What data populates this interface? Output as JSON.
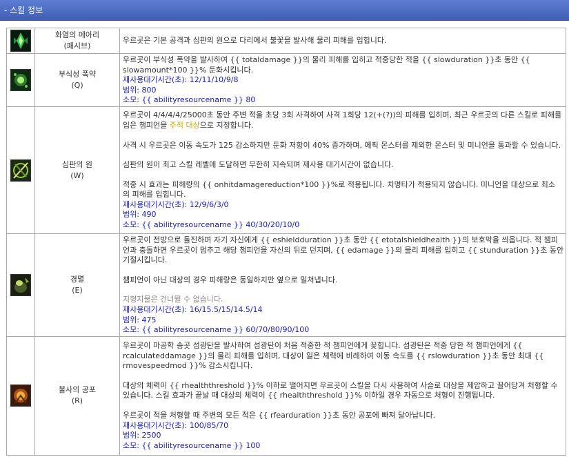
{
  "header": {
    "title": "- 스킬 정보"
  },
  "skills": [
    {
      "name": "화염의 메아리",
      "key": "(패시브)",
      "icon": "flame-crest-icon",
      "desc": "우르곳은 기본 공격과 심판의 원으로 다리에서 불꽃을 발사해 물리 피해를 입힙니다."
    },
    {
      "name": "부식성 폭약",
      "key": "(Q)",
      "icon": "corrosive-charge-icon",
      "desc": "우르곳이 부식성 폭약을 발사하여 {{ totaldamage }}의 물리 피해를 입히고 적중당한 적을 {{ slowduration }}초 동안 {{ slowamount*100 }}% 둔화시킵니다.",
      "cooldown": "재사용대기시간(초): 12/11/10/9/8",
      "range": "범위: 800",
      "cost": "소모: {{ abilityresourcename }} 80"
    },
    {
      "name": "심판의 원",
      "key": "(W)",
      "icon": "purge-icon",
      "desc1_a": "우르곳이 4/4/4/4/25000초 동안 주변 적을 초당 3회 사격하여 사격 1회당 12(+(?))의 피해를 입히며, 최근 우르곳의 다른 스킬로 피해를 입은 챔피언을 ",
      "desc1_hl": "주적 대상",
      "desc1_b": "으로 지정합니다.",
      "desc2": "사격 시 우르곳은 이동 속도가 125 감소하지만 둔화 저항이 40% 증가하며, 에픽 몬스터를 제외한 몬스터 및 미니언을 통과할 수 있습니다.",
      "desc3": "심판의 원이 최고 스킬 레벨에 도달하면 무한히 지속되며 재사용 대기시간이 없습니다.",
      "desc4": "적중 시 효과는 피해량의 {{ onhitdamagereduction*100 }}%로 적용됩니다. 치명타가 적용되지 않습니다. 미니언을 대상으로 최소 의 피해를 입힙니다.",
      "cooldown": "재사용대기시간(초): 12/9/6/3/0",
      "range": "범위: 490",
      "cost": "소모: {{ abilityresourcename }} 40/30/20/10/0"
    },
    {
      "name": "경멸",
      "key": "(E)",
      "icon": "disdain-icon",
      "desc1": "우르곳이 전방으로 돌진하며 자기 자신에게 {{ eshieldduration }}초 동안 {{ etotalshieldhealth }}의 보호막을 씌웁니다. 적 챔피언과 충돌하면 우르곳이 멈추고 해당 챔피언을 자신의 뒤로 던지며, {{ edamage }}의 물리 피해를 입히고 {{ stunduration }}초 동안 기절시킵니다.",
      "desc2": "챔피언이 아닌 대상의 경우 피해량은 동일하지만 옆으로 밀쳐냅니다.",
      "desc3": "지형지물은 건너뛸 수 없습니다.",
      "cooldown": "재사용대기시간(초): 16/15.5/15/14.5/14",
      "range": "범위: 475",
      "cost": "소모: {{ abilityresourcename }} 60/70/80/90/100"
    },
    {
      "name": "불사의 공포",
      "key": "(R)",
      "icon": "fear-beyond-death-icon",
      "desc1": "우르곳이 마공학 송곳 섬광탄을 발사하여 섬광탄이 처음 적중한 적 챔피언에게 꽂힙니다. 섬광탄은 적중 당한 적 챔피언에게 {{ rcalculateddamage }}의 물리 피해를 입히며, 대상이 잃은 체력에 비례하여 이동 속도를 {{ rslowduration }}초 동안 최대 {{ rmovespeedmod }}% 감소시킵니다.",
      "desc2": "대상의 체력이 {{ rhealththreshold }}% 이하로 떨어지면 우르곳이 스킬을 다시 사용하여 사슬로 대상을 제압하고 끌어당겨 처형할 수 있습니다. 스킬 효과가 끝날 때 대상의 체력이 {{ rhealththreshold }}% 이하일 경우 자동으로 처형이 진행됩니다.",
      "desc3": "우르곳이 적을 처형할 때 주변의 모든 적은 {{ rfearduration }}초 동안 공포에 빠져 달아납니다.",
      "cooldown": "재사용대기시간(초): 100/85/70",
      "range": "범위: 2500",
      "cost": "소모: {{ abilityresourcename }} 100"
    }
  ]
}
